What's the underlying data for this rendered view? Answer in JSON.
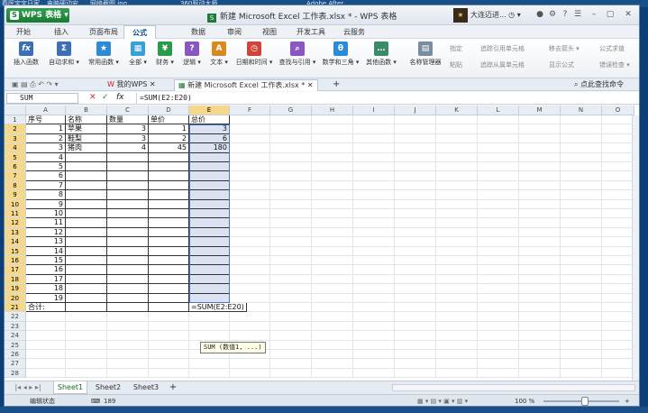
{
  "desktop": {
    "items": [
      "春晖宝宝日家",
      "电脑硬动安",
      "网络截图.jpg",
      "360驱动大师",
      "Adobe After"
    ]
  },
  "titlebar": {
    "app_button": "WPS 表格",
    "logo_letter": "S",
    "title": "新建 Microsoft Excel 工作表.xlsx * - WPS 表格",
    "user_name": "大连迈进..."
  },
  "menu": {
    "tabs": [
      "开始",
      "插入",
      "页面布局",
      "公式",
      "数据",
      "审阅",
      "视图",
      "开发工具",
      "云服务"
    ],
    "active": 3
  },
  "ribbon": {
    "buttons": [
      {
        "label": "插入函数",
        "glyph": "fx",
        "color": "#3b6fb6"
      },
      {
        "label": "自动求和 ▾",
        "glyph": "Σ",
        "color": "#3b6fb6"
      },
      {
        "label": "常用函数 ▾",
        "glyph": "★",
        "color": "#2c8bd6"
      },
      {
        "label": "全部 ▾",
        "glyph": "▦",
        "color": "#3aa0d8"
      },
      {
        "label": "财务 ▾",
        "glyph": "¥",
        "color": "#2a9a4a"
      },
      {
        "label": "逻辑 ▾",
        "glyph": "?",
        "color": "#8a56c2"
      },
      {
        "label": "文本 ▾",
        "glyph": "A",
        "color": "#d98a1e"
      },
      {
        "label": "日期和时间 ▾",
        "glyph": "◷",
        "color": "#d0453a"
      },
      {
        "label": "查找与引用 ▾",
        "glyph": "⌕",
        "color": "#8a56c2"
      },
      {
        "label": "数学和三角 ▾",
        "glyph": "θ",
        "color": "#2c8bd6"
      },
      {
        "label": "其他函数 ▾",
        "glyph": "…",
        "color": "#3b8a6a"
      },
      {
        "label": "名称管理器",
        "glyph": "▤",
        "color": "#7a8ca0"
      }
    ],
    "small": [
      "指定",
      "粘贴",
      "追踪引用单元格",
      "追踪从属单元格",
      "移去箭头 ▾",
      "显示公式",
      "公式求值",
      "错误检查 ▾"
    ]
  },
  "docbar": {
    "tabs": [
      "我的WPS",
      "新建 Microsoft Excel 工作表.xlsx *"
    ],
    "search": "点此查找命令"
  },
  "formula": {
    "namebox": "SUM",
    "content": "=SUM(E2:E20)"
  },
  "columns": [
    "A",
    "B",
    "C",
    "D",
    "E",
    "F",
    "G",
    "H",
    "I",
    "J",
    "K",
    "L",
    "M",
    "N",
    "O"
  ],
  "rows": [
    "1",
    "2",
    "3",
    "4",
    "5",
    "6",
    "7",
    "8",
    "9",
    "10",
    "11",
    "12",
    "13",
    "14",
    "15",
    "16",
    "17",
    "18",
    "19",
    "20",
    "21",
    "22",
    "23",
    "24",
    "25",
    "26",
    "27",
    "28"
  ],
  "table": {
    "header": [
      "序号",
      "名称",
      "数量",
      "单价",
      "总价"
    ],
    "data": [
      [
        "1",
        "苹果",
        "3",
        "1",
        "3"
      ],
      [
        "2",
        "鞋梨",
        "3",
        "2",
        "6"
      ],
      [
        "3",
        "猪肉",
        "4",
        "45",
        "180"
      ]
    ],
    "index_rest": [
      "4",
      "5",
      "6",
      "7",
      "8",
      "9",
      "10",
      "11",
      "12",
      "13",
      "14",
      "15",
      "16",
      "17",
      "18",
      "19"
    ],
    "total_label": "合计:",
    "total_formula": "=SUM(E2:E20)"
  },
  "tooltip": "SUM (数值1, ...)",
  "sheets": {
    "tabs": [
      "Sheet1",
      "Sheet2",
      "Sheet3"
    ],
    "add": "+"
  },
  "status": {
    "mode": "编辑状态",
    "value": "189",
    "zoom": "100 %"
  },
  "colors": {
    "accent": "#1b7a33",
    "selection": "#dbe3f3",
    "header_sel": "#f5d88a"
  }
}
